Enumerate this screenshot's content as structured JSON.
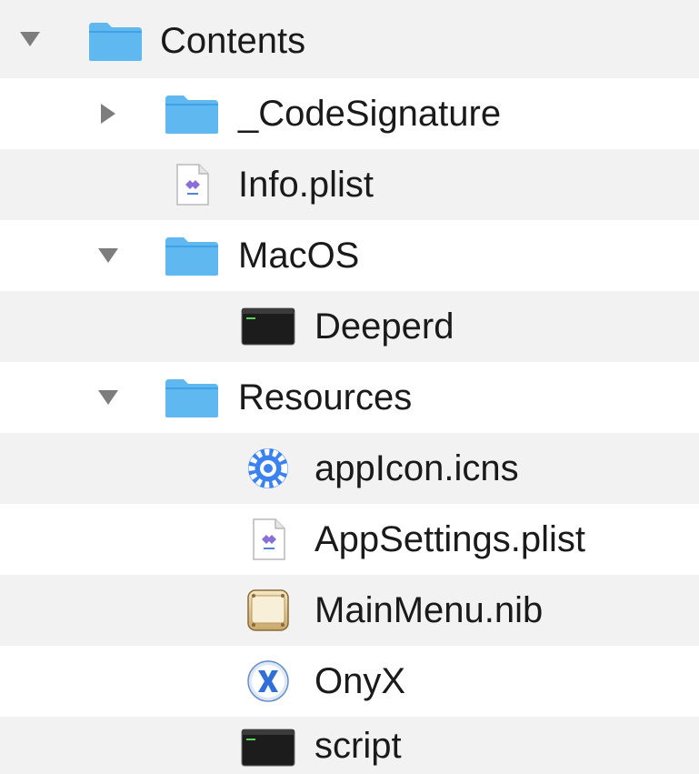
{
  "tree": {
    "items": [
      {
        "label": "Contents",
        "icon": "folder-icon",
        "disclosure": "expanded"
      },
      {
        "label": "_CodeSignature",
        "icon": "folder-icon",
        "disclosure": "collapsed"
      },
      {
        "label": "Info.plist",
        "icon": "plist-file-icon",
        "disclosure": "none"
      },
      {
        "label": "MacOS",
        "icon": "folder-icon",
        "disclosure": "expanded"
      },
      {
        "label": "Deeperd",
        "icon": "terminal-exec-icon",
        "disclosure": "none"
      },
      {
        "label": "Resources",
        "icon": "folder-icon",
        "disclosure": "expanded"
      },
      {
        "label": "appIcon.icns",
        "icon": "icns-file-icon",
        "disclosure": "none"
      },
      {
        "label": "AppSettings.plist",
        "icon": "plist-file-icon",
        "disclosure": "none"
      },
      {
        "label": "MainMenu.nib",
        "icon": "nib-file-icon",
        "disclosure": "none"
      },
      {
        "label": "OnyX",
        "icon": "onyx-app-icon",
        "disclosure": "none"
      },
      {
        "label": "script",
        "icon": "terminal-exec-icon",
        "disclosure": "none"
      }
    ]
  },
  "colors": {
    "folder": "#5fb8f0",
    "folder_dark": "#3fa3e6",
    "row_alt": "#f2f2f2",
    "disclosure": "#7d7d7d",
    "text": "#1a1a1a"
  }
}
